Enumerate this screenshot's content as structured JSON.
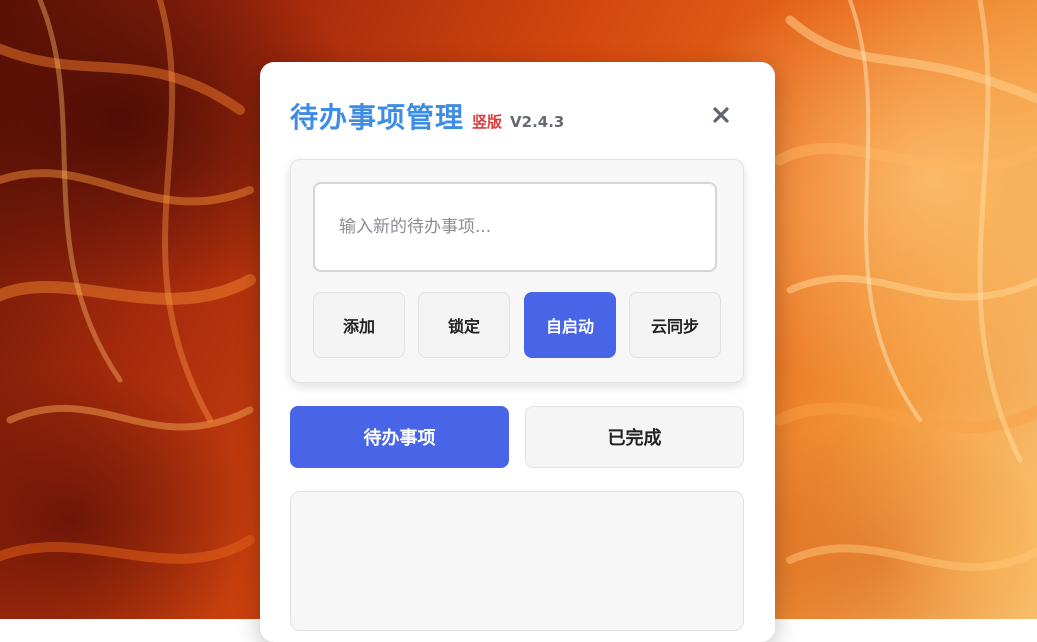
{
  "app": {
    "title": "待办事项管理",
    "badge": "竖版",
    "version": "V2.4.3"
  },
  "icons": {
    "close": "close-icon"
  },
  "input": {
    "placeholder": "输入新的待办事项...",
    "value": ""
  },
  "actions": {
    "add": "添加",
    "lock": "锁定",
    "autostart": "自启动",
    "cloud_sync": "云同步",
    "active": "autostart"
  },
  "tabs": {
    "pending": "待办事项",
    "done": "已完成",
    "selected": "pending"
  },
  "colors": {
    "accent": "#4865e8",
    "title": "#3d8de6",
    "badge": "#e03a3a"
  }
}
